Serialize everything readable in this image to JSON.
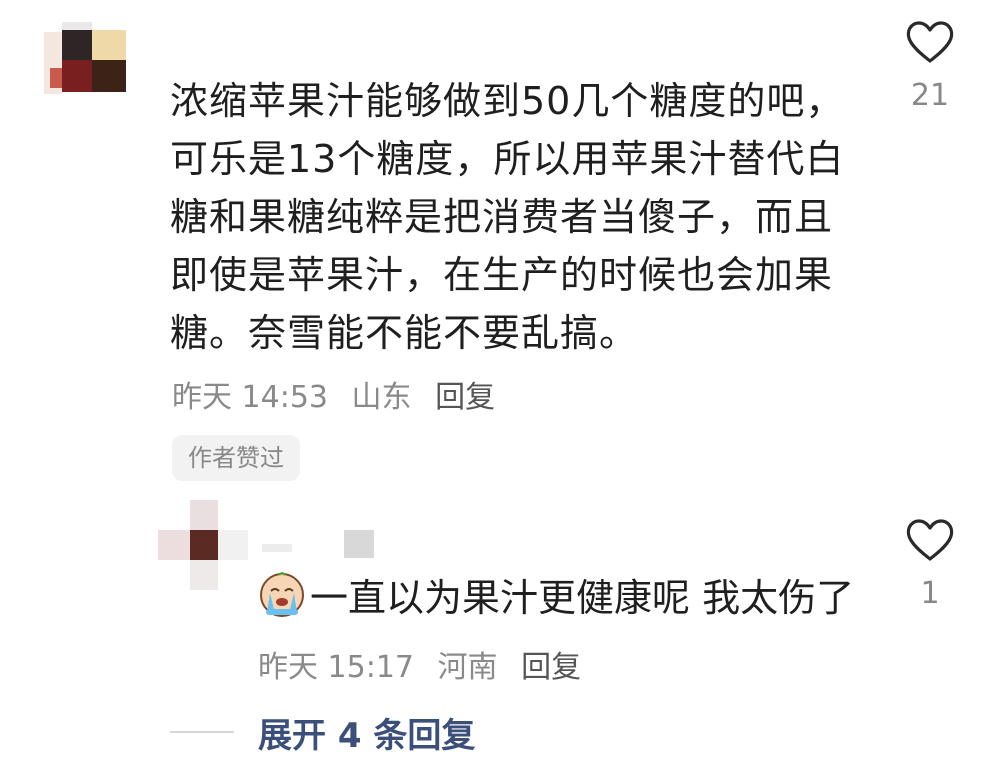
{
  "comment": {
    "lines": [
      "浓缩苹果汁能够做到50几个糖度的吧，",
      "可乐是13个糖度，所以用苹果汁替代白",
      "糖和果糖纯粹是把消费者当傻子，而且",
      "即使是苹果汁，在生产的时候也会加果",
      "糖。奈雪能不能不要乱搞。"
    ],
    "time": "昨天 14:53",
    "location": "山东",
    "reply_label": "回复",
    "author_liked": "作者赞过",
    "like_count": "21",
    "like_icon": "heart-outline-icon"
  },
  "reply": {
    "emoji_icon": "crying-face-emoji-icon",
    "text": "一直以为果汁更健康呢 我太伤了",
    "time": "昨天 15:17",
    "location": "河南",
    "reply_label": "回复",
    "like_count": "1",
    "like_icon": "heart-outline-icon"
  },
  "expand_label": "展开 4 条回复",
  "colors": {
    "text": "#1f1f1f",
    "meta": "#8a8a8a",
    "link": "#3b4f7a",
    "badge_bg": "#f2f2f2"
  }
}
